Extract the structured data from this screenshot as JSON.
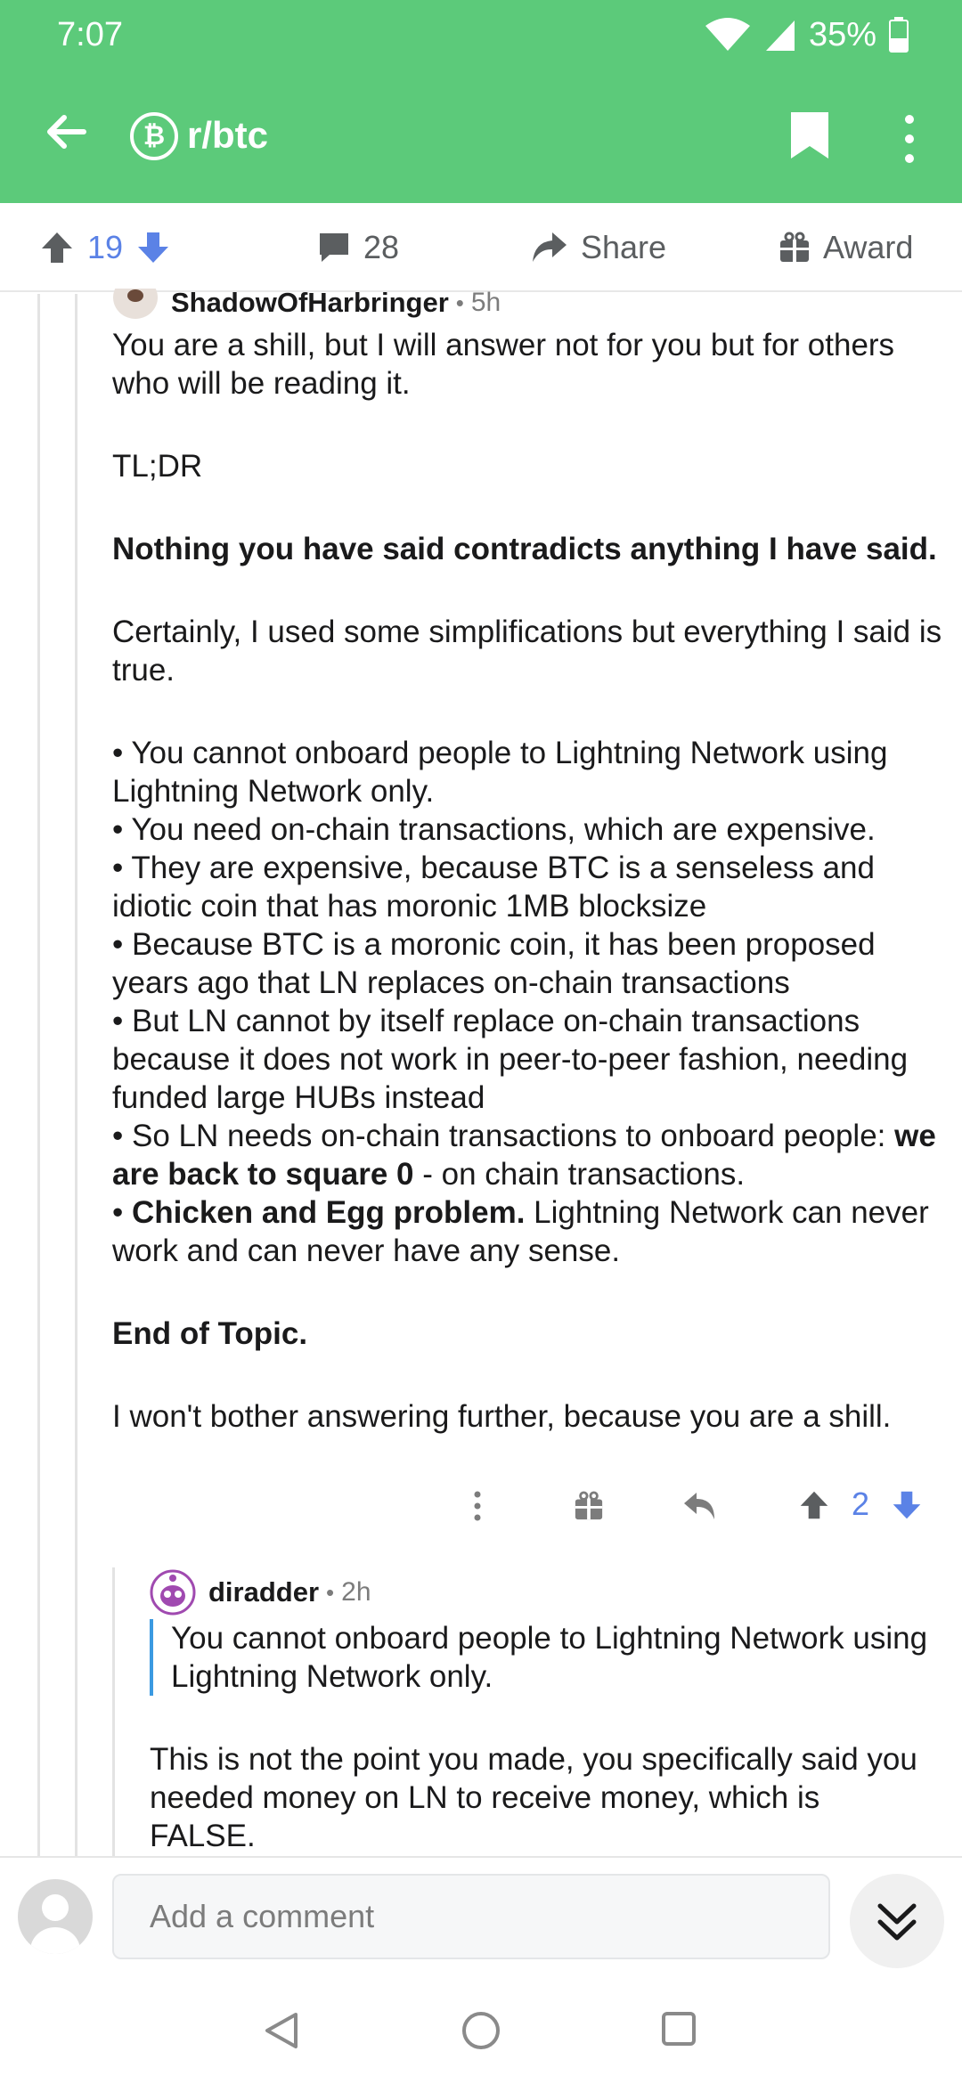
{
  "status_bar": {
    "time": "7:07",
    "battery": "35%"
  },
  "header": {
    "subreddit": "r/btc",
    "sub_icon_glyph": "₿"
  },
  "action_bar": {
    "upvotes": "19",
    "comments": "28",
    "share_label": "Share",
    "award_label": "Award"
  },
  "comment": {
    "author": "ShadowOfHarbringer",
    "dot": "•",
    "age": "5h",
    "p1": "You are a shill, but I will answer not for you but for others who will be reading it.",
    "p2": "TL;DR",
    "p3": "Nothing you have said contradicts anything I have said.",
    "p4": "Certainly, I used some simplifications but everything I said is true.",
    "bullets": {
      "b1": "• You cannot onboard people to Lightning Network using Lightning Network only.",
      "b2": "• You need on-chain transactions, which are expensive.",
      "b3": "• They are expensive, because BTC is a senseless and idiotic coin that has moronic 1MB blocksize",
      "b4": "• Because BTC is a moronic coin, it has been proposed years ago that LN replaces on-chain transactions",
      "b5": "• But LN cannot by itself replace on-chain transactions because it does not work in peer-to-peer fashion, needing funded large HUBs instead",
      "b6_pre": "• So LN needs on-chain transactions to onboard people: ",
      "b6_bold": "we are back to square 0",
      "b6_post": " - on chain transactions.",
      "b7_pre": "• ",
      "b7_bold": "Chicken and Egg problem.",
      "b7_post": " Lightning Network can never work and can never have any sense."
    },
    "p5": "End of Topic.",
    "p6": "I won't bother answering further, because you are a shill.",
    "score": "2"
  },
  "reply": {
    "author": "diradder",
    "dot": "•",
    "age": "2h",
    "quote": "You cannot onboard people to Lightning Network using Lightning Network only.",
    "text": "This is not the point you made, you specifically said you needed money on LN to receive money, which is FALSE."
  },
  "composer": {
    "placeholder": "Add a comment"
  },
  "colors": {
    "header": "#5cca7a",
    "vote": "#5b82e6",
    "quote_bar": "#3b9ae1"
  }
}
